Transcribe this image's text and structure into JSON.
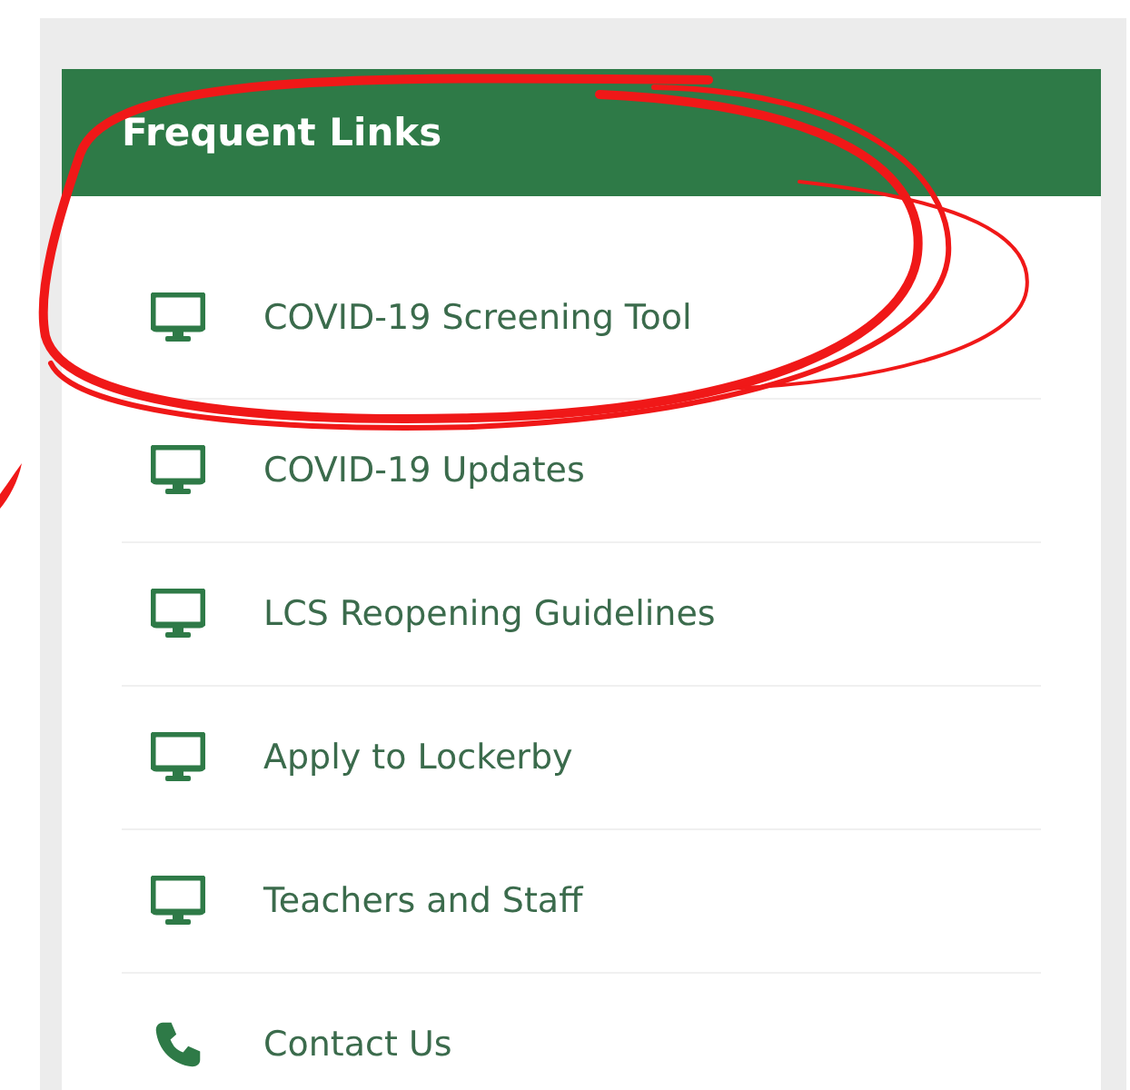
{
  "panel": {
    "title": "Frequent Links"
  },
  "links": [
    {
      "kind": "monitor",
      "label": "COVID-19 Screening Tool"
    },
    {
      "kind": "monitor",
      "label": "COVID-19 Updates"
    },
    {
      "kind": "monitor",
      "label": "LCS Reopening Guidelines"
    },
    {
      "kind": "monitor",
      "label": "Apply to Lockerby"
    },
    {
      "kind": "monitor",
      "label": "Teachers and Staff"
    },
    {
      "kind": "phone",
      "label": "Contact Us"
    }
  ]
}
